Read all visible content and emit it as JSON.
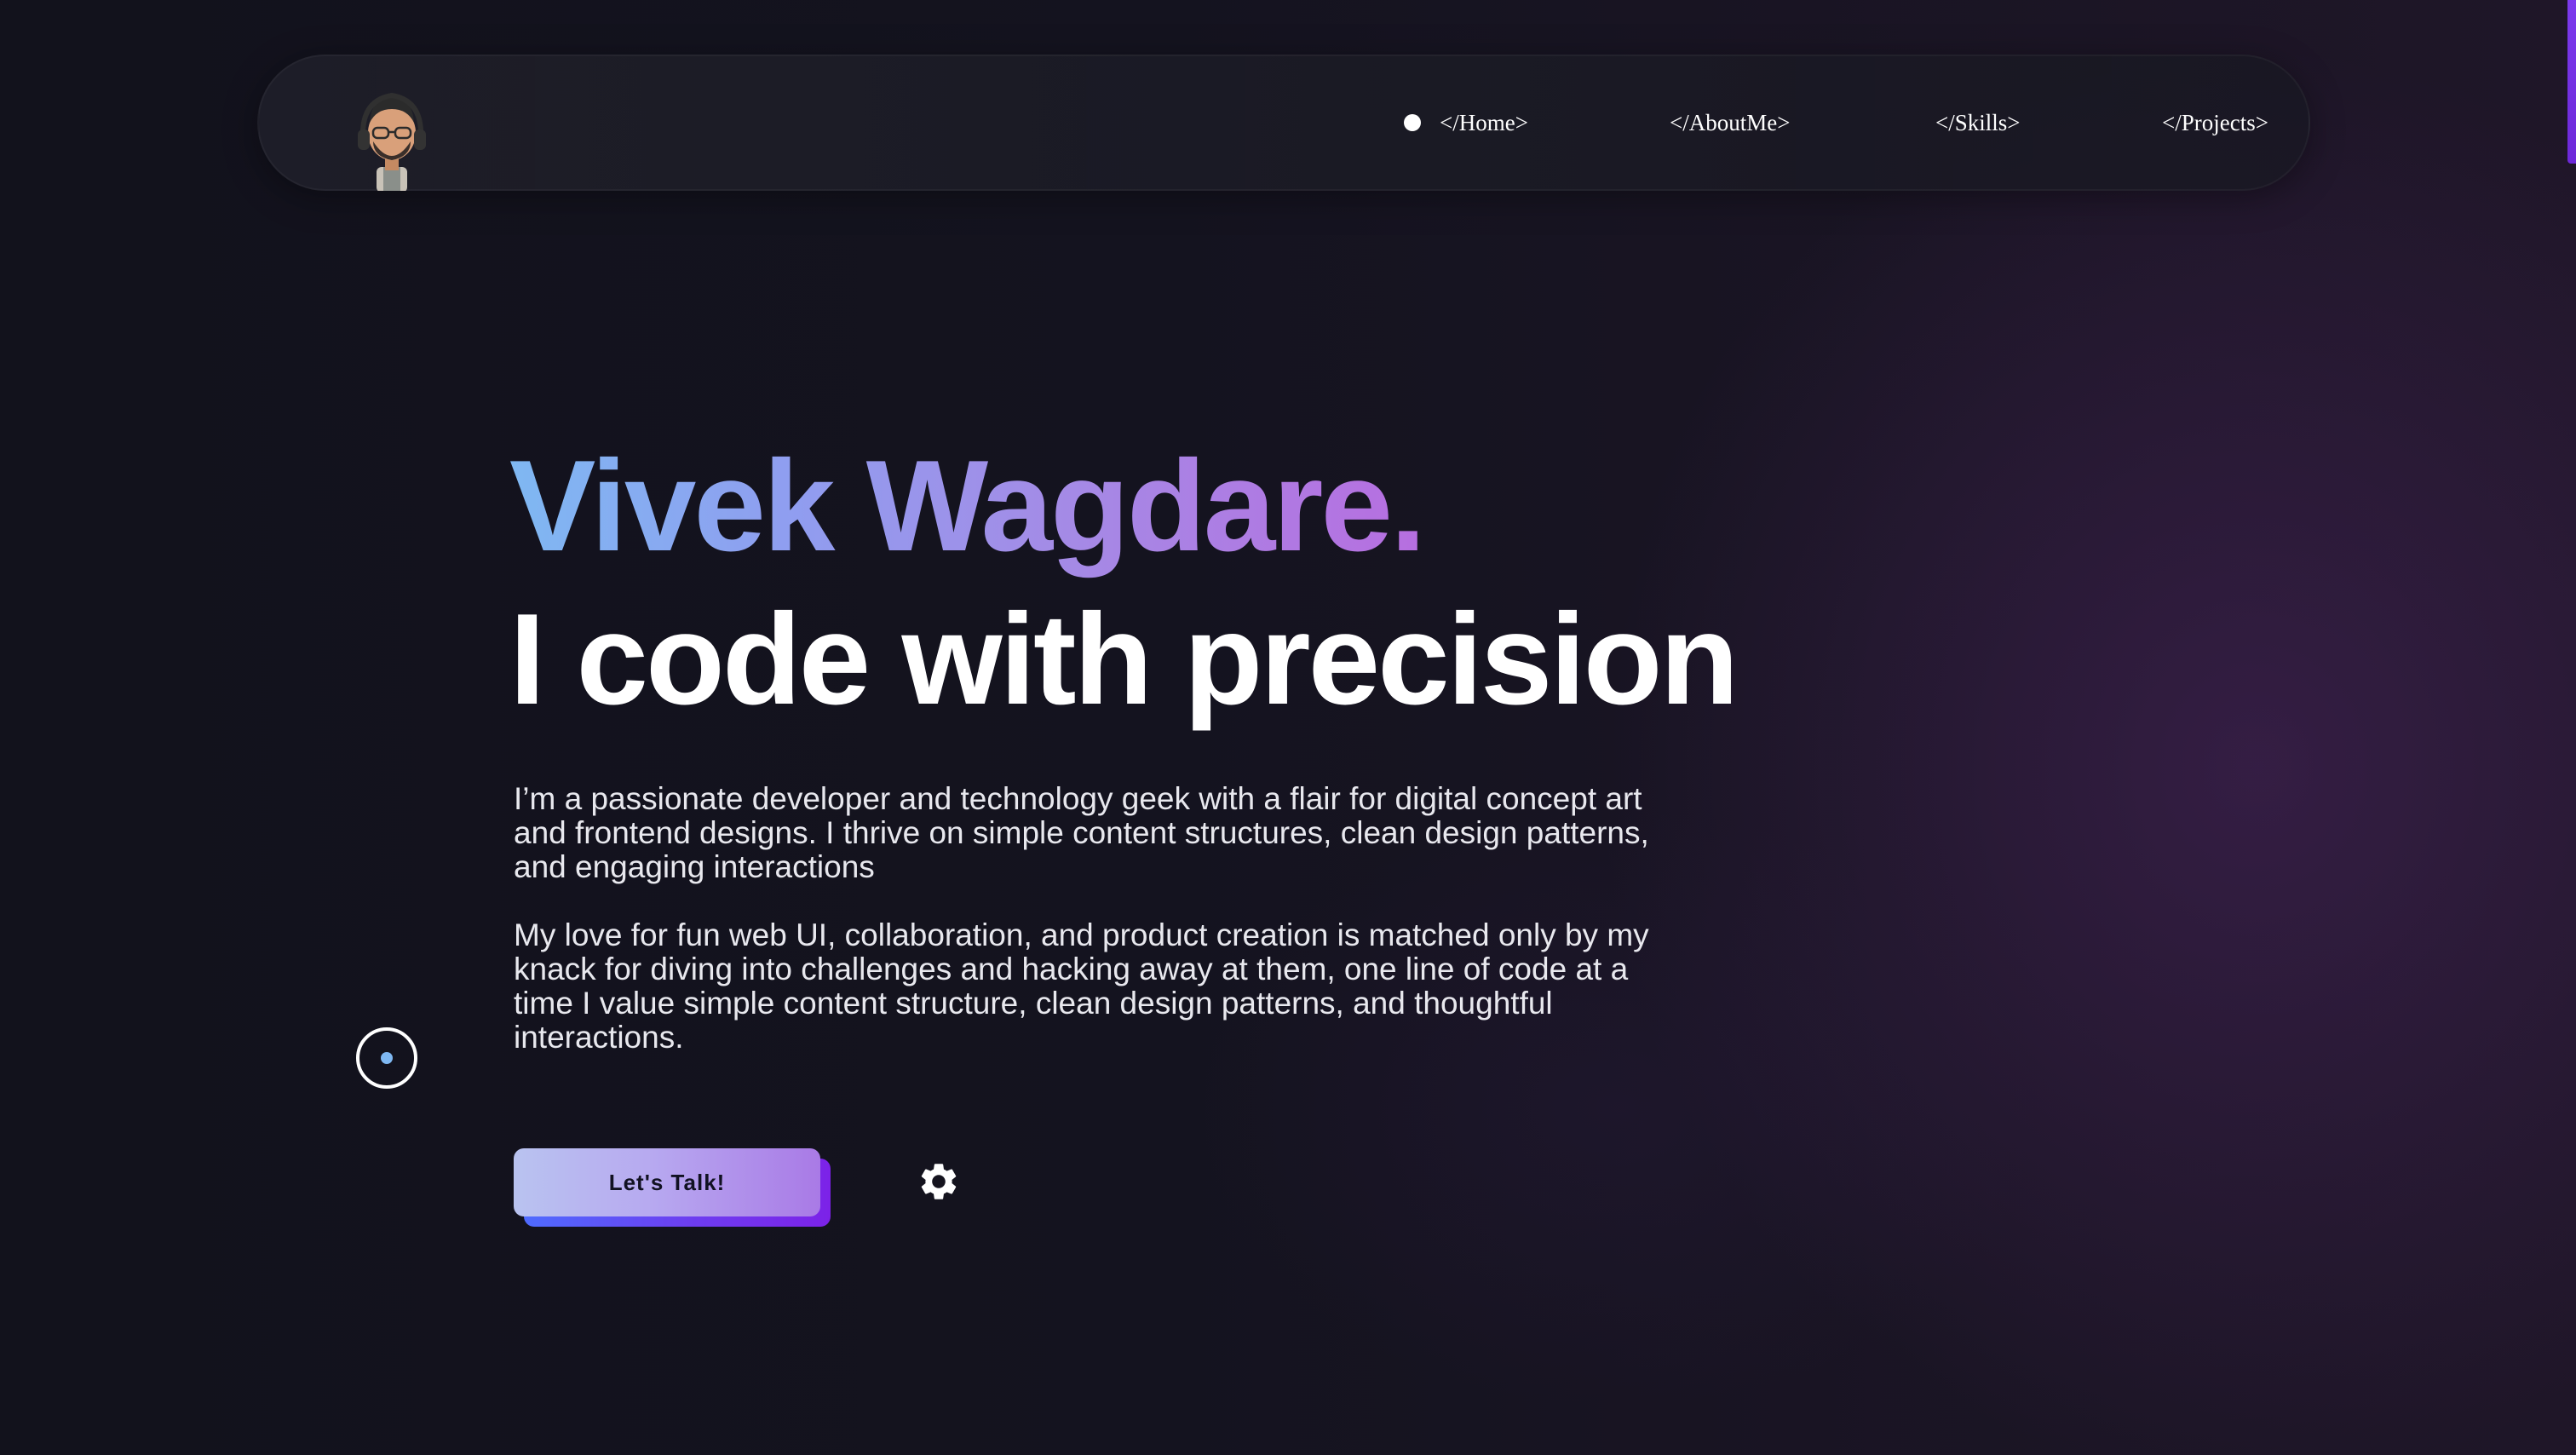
{
  "nav": {
    "avatar_icon": "memoji-avatar-with-headphones",
    "links": [
      {
        "label": "</Home>",
        "active": true
      },
      {
        "label": "</AboutMe>",
        "active": false
      },
      {
        "label": "</Skills>",
        "active": false
      },
      {
        "label": "</Projects>",
        "active": false
      }
    ]
  },
  "hero": {
    "name": "Vivek Wagdare.",
    "tagline": "I code with precision",
    "bio": [
      "I’m a passionate developer and technology geek with a flair for digital concept art and frontend designs. I thrive on simple content structures, clean design patterns, and engaging interactions",
      "My love for fun web UI, collaboration, and product creation is matched only by my knack for diving into challenges and hacking away at them, one line of code at a time I value simple content structure, clean design patterns, and thoughtful interactions."
    ],
    "cta_label": "Let's Talk!",
    "settings_icon": "gear-icon",
    "scroll_icon": "scroll-target-icon"
  },
  "colors": {
    "background": "#12121c",
    "accent_purple": "#7c3aed",
    "name_gradient_start": "#7fb8f2",
    "name_gradient_end": "#b76ee0",
    "text": "#ffffff"
  }
}
